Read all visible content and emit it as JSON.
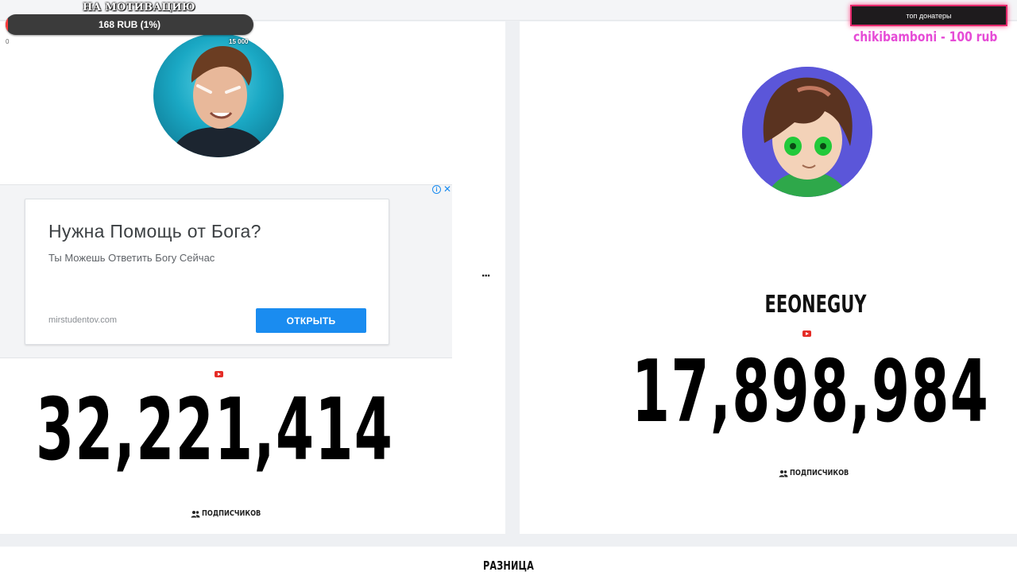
{
  "donation": {
    "goal_title": "НА МОТИВАЦИЮ",
    "progress_text": "168 RUB (1%)",
    "progress_fraction": 0.011,
    "goal_min": "0",
    "goal_max": "15 000",
    "top_donors_title": "топ донатеры",
    "top_donor": "chikibamboni - 100 rub",
    "colors": {
      "bar_bg": "#3b3b3b",
      "bar_fill": "#ff3b3b",
      "donors_border": "#e4286b",
      "donor_text": "#e64bd6"
    }
  },
  "left_channel": {
    "avatar_icon": "avatar-photo",
    "platform_icon": "youtube-icon",
    "subscriber_count": "32,221,414",
    "subscribers_label": "ПОДПИСЧИКОВ"
  },
  "right_channel": {
    "avatar_icon": "avatar-anime",
    "name": "EEONEGUY",
    "platform_icon": "youtube-icon",
    "subscriber_count": "17,898,984",
    "subscribers_label": "ПОДПИСЧИКОВ"
  },
  "ad": {
    "title": "Нужна Помощь от Бога?",
    "subtitle": "Ты Можешь Ответить Богу Сейчас",
    "domain": "mirstudentov.com",
    "button_label": "ОТКРЫТЬ",
    "choices_icon": "info-icon",
    "close_icon": "close-icon",
    "accent_color": "#1a8cf0"
  },
  "middle": {
    "ellipsis": "..."
  },
  "footer": {
    "difference_label": "РАЗНИЦА"
  }
}
